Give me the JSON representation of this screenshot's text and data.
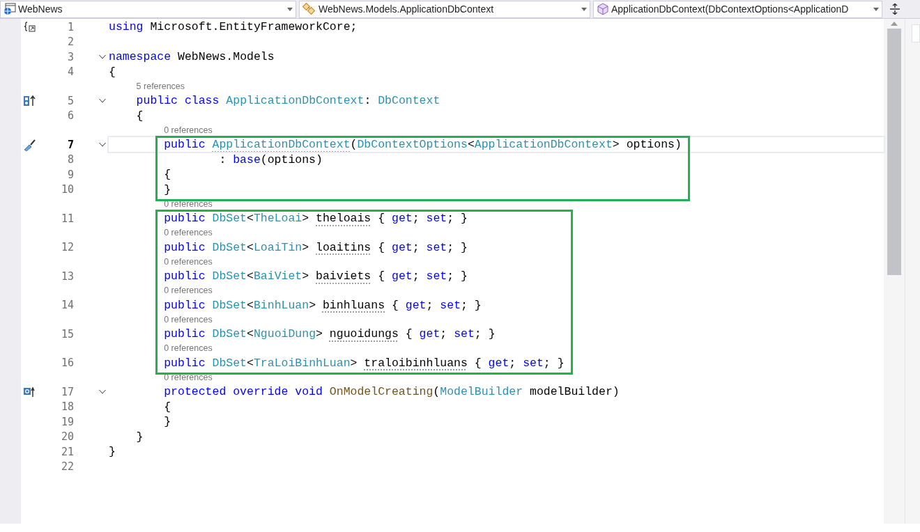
{
  "navigation_bar": {
    "project": "WebNews",
    "type": "WebNews.Models.ApplicationDbContext",
    "member": "ApplicationDbContext(DbContextOptions<ApplicationD"
  },
  "blocks": [
    {
      "kind": "plain",
      "lines": [
        {
          "number": "1",
          "kind": "statement",
          "current": false,
          "margin_icon": {
            "kind": "using"
          },
          "tokens": [
            {
              "kind": "keyword",
              "text": "using "
            },
            {
              "kind": "plain",
              "text": "Microsoft.EntityFrameworkCore;"
            }
          ]
        },
        {
          "number": "2",
          "kind": "blank",
          "current": false
        },
        {
          "number": "3",
          "kind": "statement",
          "current": false,
          "fold": {
            "expanded": true
          },
          "tokens": [
            {
              "kind": "keyword",
              "text": "namespace "
            },
            {
              "kind": "plain",
              "text": "WebNews.Models"
            }
          ]
        },
        {
          "number": "4",
          "kind": "statement",
          "current": false,
          "tokens": [
            {
              "kind": "plain",
              "text": "{"
            }
          ]
        },
        {
          "number": "5",
          "kind": "statement",
          "current": false,
          "lens": "5 references",
          "margin_icon": {
            "kind": "implemented"
          },
          "fold": {
            "expanded": true
          },
          "tokens": [
            {
              "kind": "keyword",
              "text": "public class "
            },
            {
              "kind": "type",
              "text": "ApplicationDbContext"
            },
            {
              "kind": "plain",
              "text": ": "
            },
            {
              "kind": "type",
              "text": "DbContext"
            }
          ]
        },
        {
          "number": "6",
          "kind": "statement",
          "current": false,
          "tokens": [
            {
              "kind": "plain",
              "text": "{"
            }
          ]
        }
      ]
    },
    {
      "kind": "highlighted",
      "color": "#22b14c",
      "lines": [
        {
          "number": "7",
          "kind": "statement",
          "current": true,
          "lens": "0 references",
          "margin_icon": {
            "kind": "quick-action"
          },
          "fold": {
            "expanded": true
          },
          "tokens": [
            {
              "kind": "keyword",
              "text": "public "
            },
            {
              "kind": "type-hint",
              "text": "ApplicationDbContext"
            },
            {
              "kind": "plain",
              "text": "("
            },
            {
              "kind": "type",
              "text": "DbContextOptions"
            },
            {
              "kind": "plain",
              "text": "<"
            },
            {
              "kind": "type",
              "text": "ApplicationDbContext"
            },
            {
              "kind": "plain",
              "text": "> options)"
            }
          ]
        },
        {
          "number": "8",
          "kind": "continuation",
          "current": false,
          "tokens": [
            {
              "kind": "plain",
              "text": ": "
            },
            {
              "kind": "keyword",
              "text": "base"
            },
            {
              "kind": "plain",
              "text": "(options)"
            }
          ]
        },
        {
          "number": "9",
          "kind": "statement",
          "current": false,
          "tokens": [
            {
              "kind": "plain",
              "text": "{"
            }
          ]
        },
        {
          "number": "10",
          "kind": "statement",
          "current": false,
          "tokens": [
            {
              "kind": "plain",
              "text": "}"
            }
          ]
        }
      ]
    },
    {
      "kind": "highlighted",
      "color": "#22b14c",
      "lines": [
        {
          "number": "11",
          "kind": "statement",
          "current": false,
          "lens": "0 references",
          "tokens": [
            {
              "kind": "keyword",
              "text": "public "
            },
            {
              "kind": "type",
              "text": "DbSet"
            },
            {
              "kind": "plain",
              "text": "<"
            },
            {
              "kind": "type",
              "text": "TheLoai"
            },
            {
              "kind": "plain",
              "text": "> "
            },
            {
              "kind": "hint",
              "text": "theloais"
            },
            {
              "kind": "plain",
              "text": " { "
            },
            {
              "kind": "keyword",
              "text": "get"
            },
            {
              "kind": "plain",
              "text": "; "
            },
            {
              "kind": "keyword",
              "text": "set"
            },
            {
              "kind": "plain",
              "text": "; }"
            }
          ]
        },
        {
          "number": "12",
          "kind": "statement",
          "current": false,
          "lens": "0 references",
          "tokens": [
            {
              "kind": "keyword",
              "text": "public "
            },
            {
              "kind": "type",
              "text": "DbSet"
            },
            {
              "kind": "plain",
              "text": "<"
            },
            {
              "kind": "type",
              "text": "LoaiTin"
            },
            {
              "kind": "plain",
              "text": "> "
            },
            {
              "kind": "hint",
              "text": "loaitins"
            },
            {
              "kind": "plain",
              "text": " { "
            },
            {
              "kind": "keyword",
              "text": "get"
            },
            {
              "kind": "plain",
              "text": "; "
            },
            {
              "kind": "keyword",
              "text": "set"
            },
            {
              "kind": "plain",
              "text": "; }"
            }
          ]
        },
        {
          "number": "13",
          "kind": "statement",
          "current": false,
          "lens": "0 references",
          "tokens": [
            {
              "kind": "keyword",
              "text": "public "
            },
            {
              "kind": "type",
              "text": "DbSet"
            },
            {
              "kind": "plain",
              "text": "<"
            },
            {
              "kind": "type",
              "text": "BaiViet"
            },
            {
              "kind": "plain",
              "text": "> "
            },
            {
              "kind": "hint",
              "text": "baiviets"
            },
            {
              "kind": "plain",
              "text": " { "
            },
            {
              "kind": "keyword",
              "text": "get"
            },
            {
              "kind": "plain",
              "text": "; "
            },
            {
              "kind": "keyword",
              "text": "set"
            },
            {
              "kind": "plain",
              "text": "; }"
            }
          ]
        },
        {
          "number": "14",
          "kind": "statement",
          "current": false,
          "lens": "0 references",
          "tokens": [
            {
              "kind": "keyword",
              "text": "public "
            },
            {
              "kind": "type",
              "text": "DbSet"
            },
            {
              "kind": "plain",
              "text": "<"
            },
            {
              "kind": "type",
              "text": "BinhLuan"
            },
            {
              "kind": "plain",
              "text": "> "
            },
            {
              "kind": "hint",
              "text": "binhluans"
            },
            {
              "kind": "plain",
              "text": " { "
            },
            {
              "kind": "keyword",
              "text": "get"
            },
            {
              "kind": "plain",
              "text": "; "
            },
            {
              "kind": "keyword",
              "text": "set"
            },
            {
              "kind": "plain",
              "text": "; }"
            }
          ]
        },
        {
          "number": "15",
          "kind": "statement",
          "current": false,
          "lens": "0 references",
          "tokens": [
            {
              "kind": "keyword",
              "text": "public "
            },
            {
              "kind": "type",
              "text": "DbSet"
            },
            {
              "kind": "plain",
              "text": "<"
            },
            {
              "kind": "type",
              "text": "NguoiDung"
            },
            {
              "kind": "plain",
              "text": "> "
            },
            {
              "kind": "hint",
              "text": "nguoidungs"
            },
            {
              "kind": "plain",
              "text": " { "
            },
            {
              "kind": "keyword",
              "text": "get"
            },
            {
              "kind": "plain",
              "text": "; "
            },
            {
              "kind": "keyword",
              "text": "set"
            },
            {
              "kind": "plain",
              "text": "; }"
            }
          ]
        },
        {
          "number": "16",
          "kind": "statement",
          "current": false,
          "lens": "0 references",
          "tokens": [
            {
              "kind": "keyword",
              "text": "public "
            },
            {
              "kind": "type",
              "text": "DbSet"
            },
            {
              "kind": "plain",
              "text": "<"
            },
            {
              "kind": "type",
              "text": "TraLoiBinhLuan"
            },
            {
              "kind": "plain",
              "text": "> "
            },
            {
              "kind": "hint",
              "text": "traloibinhluans"
            },
            {
              "kind": "plain",
              "text": " { "
            },
            {
              "kind": "keyword",
              "text": "get"
            },
            {
              "kind": "plain",
              "text": "; "
            },
            {
              "kind": "keyword",
              "text": "set"
            },
            {
              "kind": "plain",
              "text": "; }"
            }
          ]
        }
      ]
    },
    {
      "kind": "plain",
      "lines": [
        {
          "number": "17",
          "kind": "statement",
          "current": false,
          "lens": "0 references",
          "margin_icon": {
            "kind": "override"
          },
          "fold": {
            "expanded": true
          },
          "tokens": [
            {
              "kind": "keyword",
              "text": "protected override void "
            },
            {
              "kind": "method",
              "text": "OnModelCreating"
            },
            {
              "kind": "plain",
              "text": "("
            },
            {
              "kind": "type",
              "text": "ModelBuilder"
            },
            {
              "kind": "plain",
              "text": " modelBuilder)"
            }
          ]
        },
        {
          "number": "18",
          "kind": "statement",
          "current": false,
          "tokens": [
            {
              "kind": "plain",
              "text": "{"
            }
          ]
        },
        {
          "number": "19",
          "kind": "statement",
          "current": false,
          "tokens": [
            {
              "kind": "plain",
              "text": "}"
            }
          ]
        },
        {
          "number": "20",
          "kind": "statement",
          "current": false,
          "tokens": [
            {
              "kind": "plain",
              "text": "}"
            }
          ]
        },
        {
          "number": "21",
          "kind": "statement",
          "current": false,
          "tokens": [
            {
              "kind": "plain",
              "text": "}"
            }
          ]
        },
        {
          "number": "22",
          "kind": "blank",
          "current": false
        }
      ]
    }
  ]
}
